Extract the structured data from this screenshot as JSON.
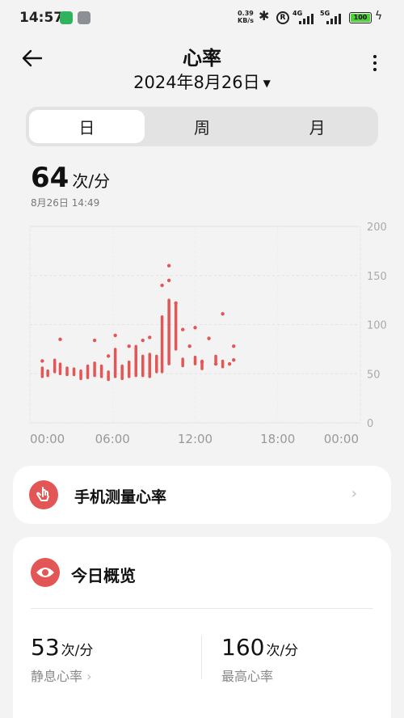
{
  "status_bar": {
    "time": "14:57",
    "net_speed_value": "0.39",
    "net_speed_unit": "KB/s",
    "sim1_label": "4G",
    "sim2_label": "5G",
    "battery": "100"
  },
  "header": {
    "title": "心率",
    "date": "2024年8月26日"
  },
  "tabs": [
    {
      "label": "日",
      "active": true
    },
    {
      "label": "周",
      "active": false
    },
    {
      "label": "月",
      "active": false
    }
  ],
  "current": {
    "value": "64",
    "unit": "次/分",
    "timestamp": "8月26日 14:49"
  },
  "chart_data": {
    "type": "range-bar",
    "x_tick_labels": [
      "00:00",
      "06:00",
      "12:00",
      "18:00",
      "00:00"
    ],
    "y_tick_labels": [
      "200",
      "150",
      "100",
      "50",
      "0"
    ],
    "ylim": [
      0,
      200
    ],
    "xlim_hours": [
      0,
      24
    ],
    "grid": true,
    "color": "#e25656",
    "ranges": [
      {
        "hour": 0.9,
        "min": 47,
        "max": 56
      },
      {
        "hour": 1.3,
        "min": 48,
        "max": 53
      },
      {
        "hour": 1.8,
        "min": 52,
        "max": 64
      },
      {
        "hour": 2.2,
        "min": 50,
        "max": 60
      },
      {
        "hour": 2.7,
        "min": 49,
        "max": 56
      },
      {
        "hour": 3.2,
        "min": 49,
        "max": 55
      },
      {
        "hour": 3.7,
        "min": 45,
        "max": 53
      },
      {
        "hour": 4.2,
        "min": 46,
        "max": 58
      },
      {
        "hour": 4.7,
        "min": 48,
        "max": 61
      },
      {
        "hour": 5.2,
        "min": 47,
        "max": 58
      },
      {
        "hour": 5.7,
        "min": 44,
        "max": 52
      },
      {
        "hour": 6.2,
        "min": 47,
        "max": 75
      },
      {
        "hour": 6.7,
        "min": 45,
        "max": 58
      },
      {
        "hour": 7.2,
        "min": 47,
        "max": 62
      },
      {
        "hour": 7.7,
        "min": 48,
        "max": 78
      },
      {
        "hour": 8.2,
        "min": 48,
        "max": 68
      },
      {
        "hour": 8.7,
        "min": 47,
        "max": 70
      },
      {
        "hour": 9.2,
        "min": 52,
        "max": 68
      },
      {
        "hour": 9.6,
        "min": 52,
        "max": 108
      },
      {
        "hour": 10.1,
        "min": 60,
        "max": 125
      },
      {
        "hour": 10.6,
        "min": 75,
        "max": 122
      },
      {
        "hour": 11.1,
        "min": 58,
        "max": 65
      },
      {
        "hour": 12.0,
        "min": 60,
        "max": 67
      },
      {
        "hour": 12.5,
        "min": 55,
        "max": 63
      },
      {
        "hour": 13.5,
        "min": 62,
        "max": 68
      },
      {
        "hour": 14.0,
        "min": 57,
        "max": 63
      }
    ],
    "points": [
      {
        "hour": 0.9,
        "value": 63
      },
      {
        "hour": 2.2,
        "value": 85
      },
      {
        "hour": 4.7,
        "value": 84
      },
      {
        "hour": 5.7,
        "value": 68
      },
      {
        "hour": 6.2,
        "value": 89
      },
      {
        "hour": 7.2,
        "value": 78
      },
      {
        "hour": 8.2,
        "value": 84
      },
      {
        "hour": 8.7,
        "value": 87
      },
      {
        "hour": 9.6,
        "value": 140
      },
      {
        "hour": 10.1,
        "value": 145
      },
      {
        "hour": 10.1,
        "value": 160
      },
      {
        "hour": 10.6,
        "value": 122
      },
      {
        "hour": 11.1,
        "value": 95
      },
      {
        "hour": 11.6,
        "value": 78
      },
      {
        "hour": 12.0,
        "value": 97
      },
      {
        "hour": 12.5,
        "value": 62
      },
      {
        "hour": 13.0,
        "value": 86
      },
      {
        "hour": 13.5,
        "value": 60
      },
      {
        "hour": 14.0,
        "value": 111
      },
      {
        "hour": 14.5,
        "value": 60
      },
      {
        "hour": 14.8,
        "value": 78
      },
      {
        "hour": 14.8,
        "value": 64
      }
    ]
  },
  "measure_card": {
    "label": "手机测量心率"
  },
  "overview": {
    "title": "今日概览",
    "resting_value": "53",
    "resting_unit": "次/分",
    "resting_label": "静息心率",
    "max_value": "160",
    "max_unit": "次/分",
    "max_label": "最高心率"
  }
}
